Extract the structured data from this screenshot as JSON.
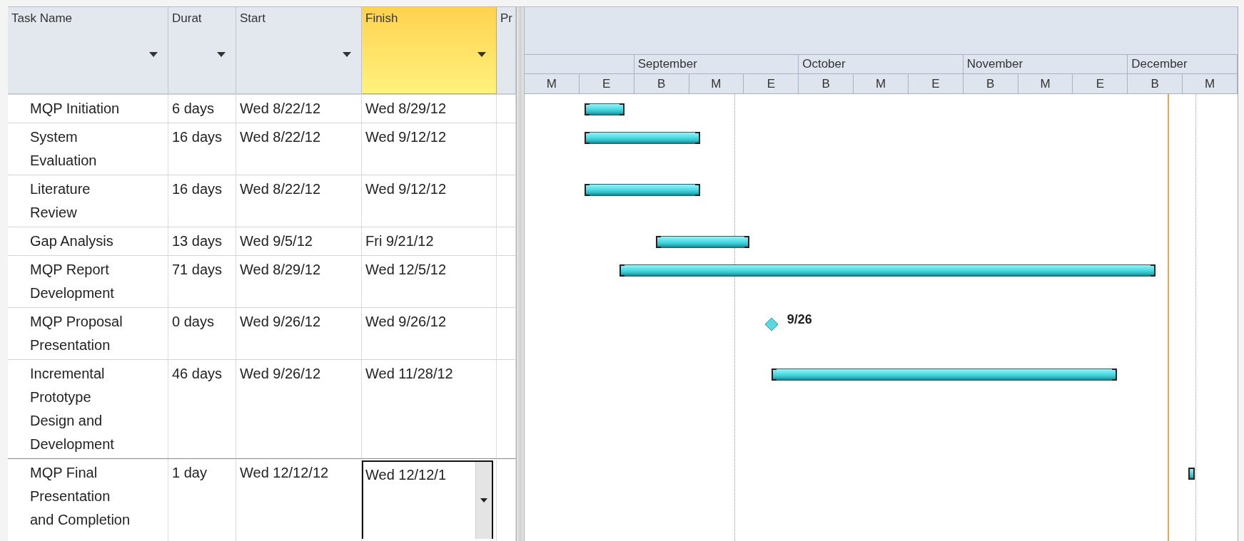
{
  "columns": [
    {
      "label": "Task Name",
      "selected": false
    },
    {
      "label": "Durat",
      "selected": false
    },
    {
      "label": "Start",
      "selected": false
    },
    {
      "label": "Finish",
      "selected": true
    },
    {
      "label": "Pr",
      "selected": false
    }
  ],
  "timescale": [
    {
      "periods": [
        "M",
        "E"
      ]
    },
    {
      "label": "September",
      "periods": [
        "B",
        "M",
        "E"
      ]
    },
    {
      "label": "October",
      "periods": [
        "B",
        "M",
        "E"
      ]
    },
    {
      "label": "November",
      "periods": [
        "B",
        "M",
        "E"
      ]
    },
    {
      "label": "December",
      "periods": [
        "B",
        "M"
      ]
    }
  ],
  "tasks": [
    {
      "kind": "task",
      "name": "MQP Initiation",
      "duration": "6 days",
      "start": "Wed 8/22/12",
      "finish": "Wed 8/29/12",
      "selected": false,
      "editing": false
    },
    {
      "kind": "task",
      "name": "System Evaluation",
      "duration": "16 days",
      "start": "Wed 8/22/12",
      "finish": "Wed 9/12/12",
      "selected": false,
      "editing": false
    },
    {
      "kind": "task",
      "name": "Literature Review",
      "duration": "16 days",
      "start": "Wed 8/22/12",
      "finish": "Wed 9/12/12",
      "selected": false,
      "editing": false
    },
    {
      "kind": "task",
      "name": "Gap Analysis",
      "duration": "13 days",
      "start": "Wed 9/5/12",
      "finish": "Fri 9/21/12",
      "selected": false,
      "editing": false
    },
    {
      "kind": "task",
      "name": "MQP Report Development",
      "duration": "71 days",
      "start": "Wed 8/29/12",
      "finish": "Wed 12/5/12",
      "selected": false,
      "editing": false
    },
    {
      "kind": "milestone",
      "name": "MQP Proposal Presentation",
      "duration": "0 days",
      "start": "Wed 9/26/12",
      "finish": "Wed 9/26/12",
      "milestone_label": "9/26",
      "selected": false,
      "editing": false
    },
    {
      "kind": "task",
      "name": "Incremental Prototype Design and Development",
      "duration": "46 days",
      "start": "Wed 9/26/12",
      "finish": "Wed 11/28/12",
      "selected": false,
      "editing": false
    },
    {
      "kind": "task",
      "name": "MQP Final Presentation and Completion",
      "duration": "1 day",
      "start": "Wed 12/12/12",
      "finish": "Wed 12/12/1",
      "selected": true,
      "editing": true
    }
  ]
}
